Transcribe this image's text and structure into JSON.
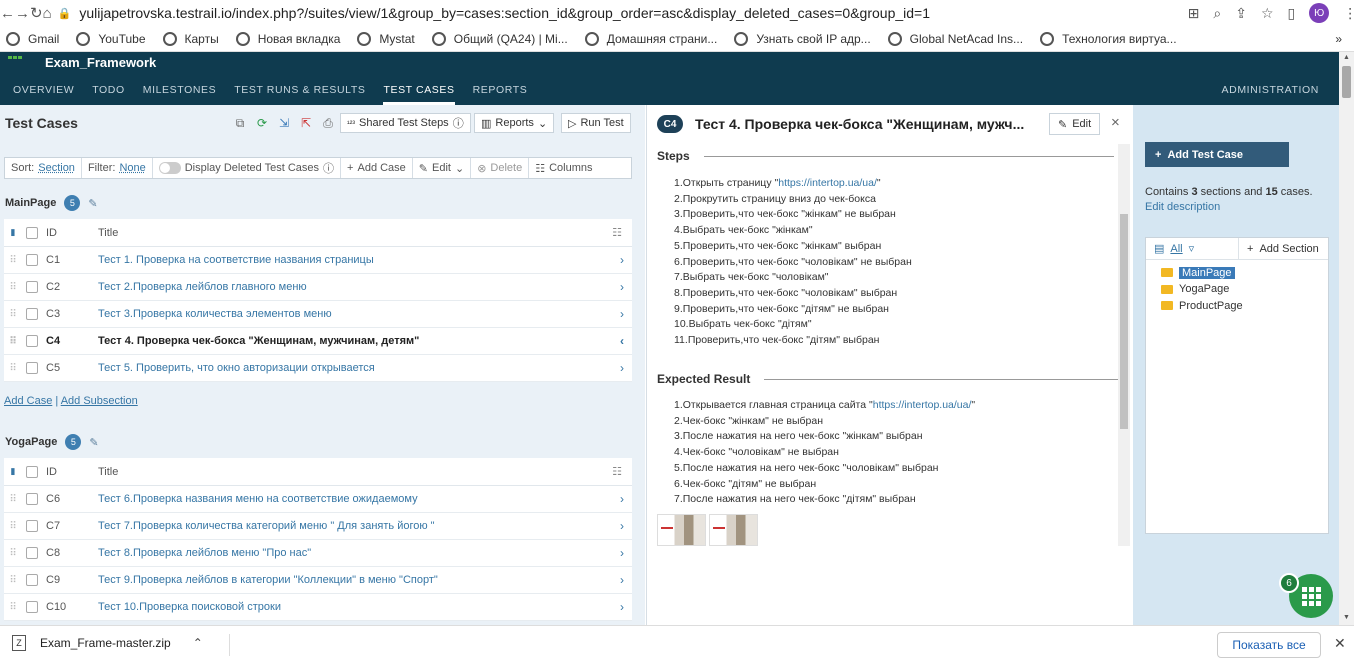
{
  "browser": {
    "url": "yulijapetrovska.testrail.io/index.php?/suites/view/1&group_by=cases:section_id&group_order=asc&display_deleted_cases=0&group_id=1",
    "profile_initials": "Ю",
    "bookmarks": [
      "Gmail",
      "YouTube",
      "Карты",
      "Новая вкладка",
      "Mystat",
      "Общий (QA24) | Mi...",
      "Домашняя страни...",
      "Узнать свой IP адр...",
      "Global NetAcad Ins...",
      "Технология виртуа..."
    ],
    "more_bookmarks": "»"
  },
  "app": {
    "project": "Exam_Framework",
    "tabs": [
      "OVERVIEW",
      "TODO",
      "MILESTONES",
      "TEST RUNS & RESULTS",
      "TEST CASES",
      "REPORTS"
    ],
    "admin": "ADMINISTRATION"
  },
  "left": {
    "title": "Test Cases",
    "shared_steps": "Shared Test Steps",
    "reports": "Reports",
    "run_test": "Run Test",
    "sort_label": "Sort:",
    "sort_value": "Section",
    "filter_label": "Filter:",
    "filter_value": "None",
    "deleted_label": "Display Deleted Test Cases",
    "add_case": "Add Case",
    "edit": "Edit",
    "delete": "Delete",
    "columns": "Columns",
    "col_id": "ID",
    "col_title": "Title",
    "add_case_link": "Add Case",
    "add_subsection_link": "Add Subsection",
    "sections": [
      {
        "name": "MainPage",
        "count": "5",
        "rows": [
          {
            "id": "C1",
            "title": "Тест 1. Проверка на соответствие названия страницы"
          },
          {
            "id": "C2",
            "title": "Тест 2.Проверка лейблов главного меню"
          },
          {
            "id": "C3",
            "title": "Тест 3.Проверка количества элементов меню"
          },
          {
            "id": "C4",
            "title": "Тест 4. Проверка чек-бокса \"Женщинам, мужчинам, детям\""
          },
          {
            "id": "C5",
            "title": "Тест 5. Проверить, что окно авторизации открывается"
          }
        ]
      },
      {
        "name": "YogaPage",
        "count": "5",
        "rows": [
          {
            "id": "C6",
            "title": "Тест 6.Проверка названия меню на соответствие ожидаемому"
          },
          {
            "id": "C7",
            "title": "Тест 7.Проверка количества категорий меню \" Для занять йогою \""
          },
          {
            "id": "C8",
            "title": "Тест 8.Проверка лейблов меню \"Про нас\""
          },
          {
            "id": "C9",
            "title": "Тест 9.Проверка лейблов в категории \"Коллекции\" в меню \"Спорт\""
          },
          {
            "id": "C10",
            "title": "Тест 10.Проверка поисковой строки"
          }
        ]
      }
    ]
  },
  "detail": {
    "badge": "C4",
    "title": "Тест 4. Проверка чек-бокса \"Женщинам, мужч...",
    "edit": "Edit",
    "steps_heading": "Steps",
    "steps": {
      "s1_pre": "1.Открыть страницу \"",
      "s1_url": "https://intertop.ua/ua/",
      "s1_post": "\"",
      "s2": "2.Прокрутить страницу вниз до чек-бокса",
      "s3": "3.Проверить,что чек-бокс \"жінкам\" не выбран",
      "s4": "4.Выбрать чек-бокс \"жінкам\"",
      "s5": "5.Проверить,что чек-бокс \"жінкам\" выбран",
      "s6": "6.Проверить,что чек-бокс \"чоловікам\" не выбран",
      "s7": "7.Выбрать чек-бокс \"чоловікам\"",
      "s8": "8.Проверить,что чек-бокс \"чоловікам\" выбран",
      "s9": "9.Проверить,что чек-бокс \"дітям\" не выбран",
      "s10": "10.Выбрать чек-бокс \"дітям\"",
      "s11": "11.Проверить,что чек-бокс \"дітям\" выбран"
    },
    "expected_heading": "Expected Result",
    "expected": {
      "e1_pre": "1.Открывается главная страница сайта \"",
      "e1_url": "https://intertop.ua/ua/",
      "e1_post": "\"",
      "e2": "2.Чек-бокс \"жінкам\" не выбран",
      "e3": "3.После нажатия на него чек-бокс \"жінкам\" выбран",
      "e4": "4.Чек-бокс \"чоловікам\" не выбран",
      "e5": "5.После нажатия на него чек-бокс \"чоловікам\" выбран",
      "e6": "6.Чек-бокс \"дітям\" не выбран",
      "e7": "7.После нажатия на него чек-бокс \"дітям\" выбран"
    }
  },
  "sidebar": {
    "add_test_case": "Add Test Case",
    "contains_pre": "Contains ",
    "sections_count": "3",
    "sections_word": " sections and ",
    "cases_count": "15",
    "cases_word": " cases",
    "info_post": ". ",
    "edit_description": "Edit description",
    "all": "All",
    "add_section": "Add Section",
    "tree": [
      "MainPage",
      "YogaPage",
      "ProductPage"
    ]
  },
  "fab_count": "6",
  "downloads": {
    "file": "Exam_Frame-master.zip",
    "show_all": "Показать все"
  }
}
